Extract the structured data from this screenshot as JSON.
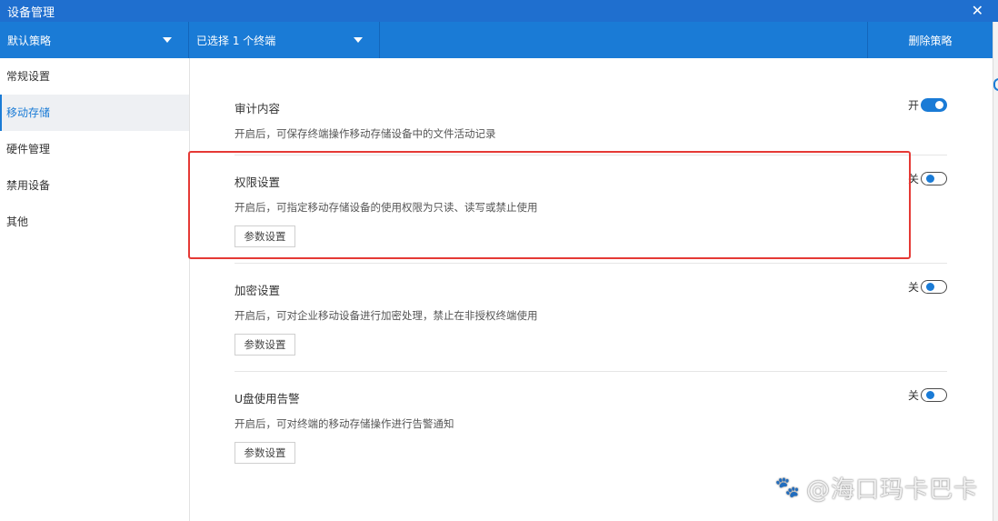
{
  "window": {
    "title": "设备管理",
    "close_glyph": "✕"
  },
  "toolbar": {
    "policy_label": "默认策略",
    "terminals_label": "已选择 1 个终端",
    "delete_label": "删除策略"
  },
  "sidebar": {
    "items": [
      {
        "label": "常规设置"
      },
      {
        "label": "移动存储"
      },
      {
        "label": "硬件管理"
      },
      {
        "label": "禁用设备"
      },
      {
        "label": "其他"
      }
    ],
    "active_index": 1
  },
  "sections": [
    {
      "title": "审计内容",
      "description": "开启后，可保存终端操作移动存储设备中的文件活动记录",
      "toggle_label": "开",
      "state": "on"
    },
    {
      "title": "权限设置",
      "description": "开启后，可指定移动存储设备的使用权限为只读、读写或禁止使用",
      "toggle_label": "关",
      "state": "off",
      "button": "参数设置"
    },
    {
      "title": "加密设置",
      "description": "开启后，可对企业移动设备进行加密处理，禁止在非授权终端使用",
      "toggle_label": "关",
      "state": "off",
      "button": "参数设置"
    },
    {
      "title": "U盘使用告警",
      "description": "开启后，可对终端的移动存储操作进行告警通知",
      "toggle_label": "关",
      "state": "off",
      "button": "参数设置"
    }
  ],
  "watermark": {
    "icon": "paw-icon",
    "text": "@海口玛卡巴卡"
  },
  "colors": {
    "titlebar": "#1f6fcf",
    "toolbar": "#1a7bd6",
    "accent": "#1a7bd6",
    "highlight": "#e53935"
  }
}
